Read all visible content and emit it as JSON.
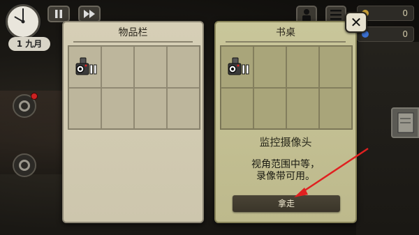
{
  "hud": {
    "date_label": "1 九月",
    "pause_icon": "pause-icon",
    "fast_forward_icon": "fast-forward-icon",
    "counter_money": "0",
    "counter_reputation": "0",
    "money_color": "#c9a13a",
    "reputation_color": "#3a6fd0"
  },
  "inventory_panel": {
    "title": "物品栏",
    "items": [
      {
        "icon": "camera-icon",
        "name": "监控摄像头"
      }
    ]
  },
  "desk_panel": {
    "title": "书桌",
    "items": [
      {
        "icon": "camera-icon",
        "name": "监控摄像头"
      }
    ],
    "selected_item": {
      "name": "监控摄像头",
      "description_line1": "视角范围中等，",
      "description_line2": "录像带可用。"
    },
    "take_button_label": "拿走"
  },
  "close_button_label": "✕",
  "annotation": {
    "arrow_color": "#e02020"
  }
}
